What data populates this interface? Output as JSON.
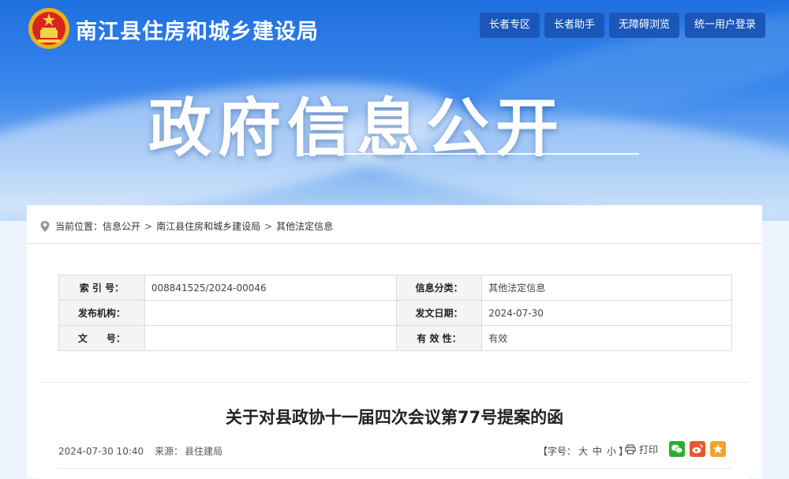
{
  "header": {
    "site_title": "南江县住房和城乡建设局",
    "buttons": [
      "长者专区",
      "长者助手",
      "无障碍浏览",
      "统一用户登录"
    ]
  },
  "banner": {
    "title": "政府信息公开"
  },
  "breadcrumb": {
    "prefix": "当前位置：",
    "items": [
      "信息公开",
      "南江县住房和城乡建设局",
      "其他法定信息"
    ],
    "separator": ">"
  },
  "meta": {
    "rows": [
      {
        "l1": "索 引 号：",
        "v1": "008841525/2024-00046",
        "l2": "信息分类：",
        "v2": "其他法定信息"
      },
      {
        "l1": "发布机构：",
        "v1": "",
        "l2": "发文日期：",
        "v2": "2024-07-30"
      },
      {
        "l1": "文　　号：",
        "v1": "",
        "l2": "有 效 性：",
        "v2": "有效"
      }
    ]
  },
  "article": {
    "title": "关于对县政协十一届四次会议第77号提案的函",
    "date": "2024-07-30 10:40",
    "source_label": "来源：",
    "source": "县住建局",
    "font_size_label": "【字号：",
    "font_large": "大",
    "font_medium": "中",
    "font_small": "小",
    "font_close": "】",
    "print_label": "打印"
  },
  "colors": {
    "top_button": "#1b56b8",
    "wechat": "#2aae2e",
    "weibo": "#e8572f",
    "favorite": "#f2a32a"
  }
}
